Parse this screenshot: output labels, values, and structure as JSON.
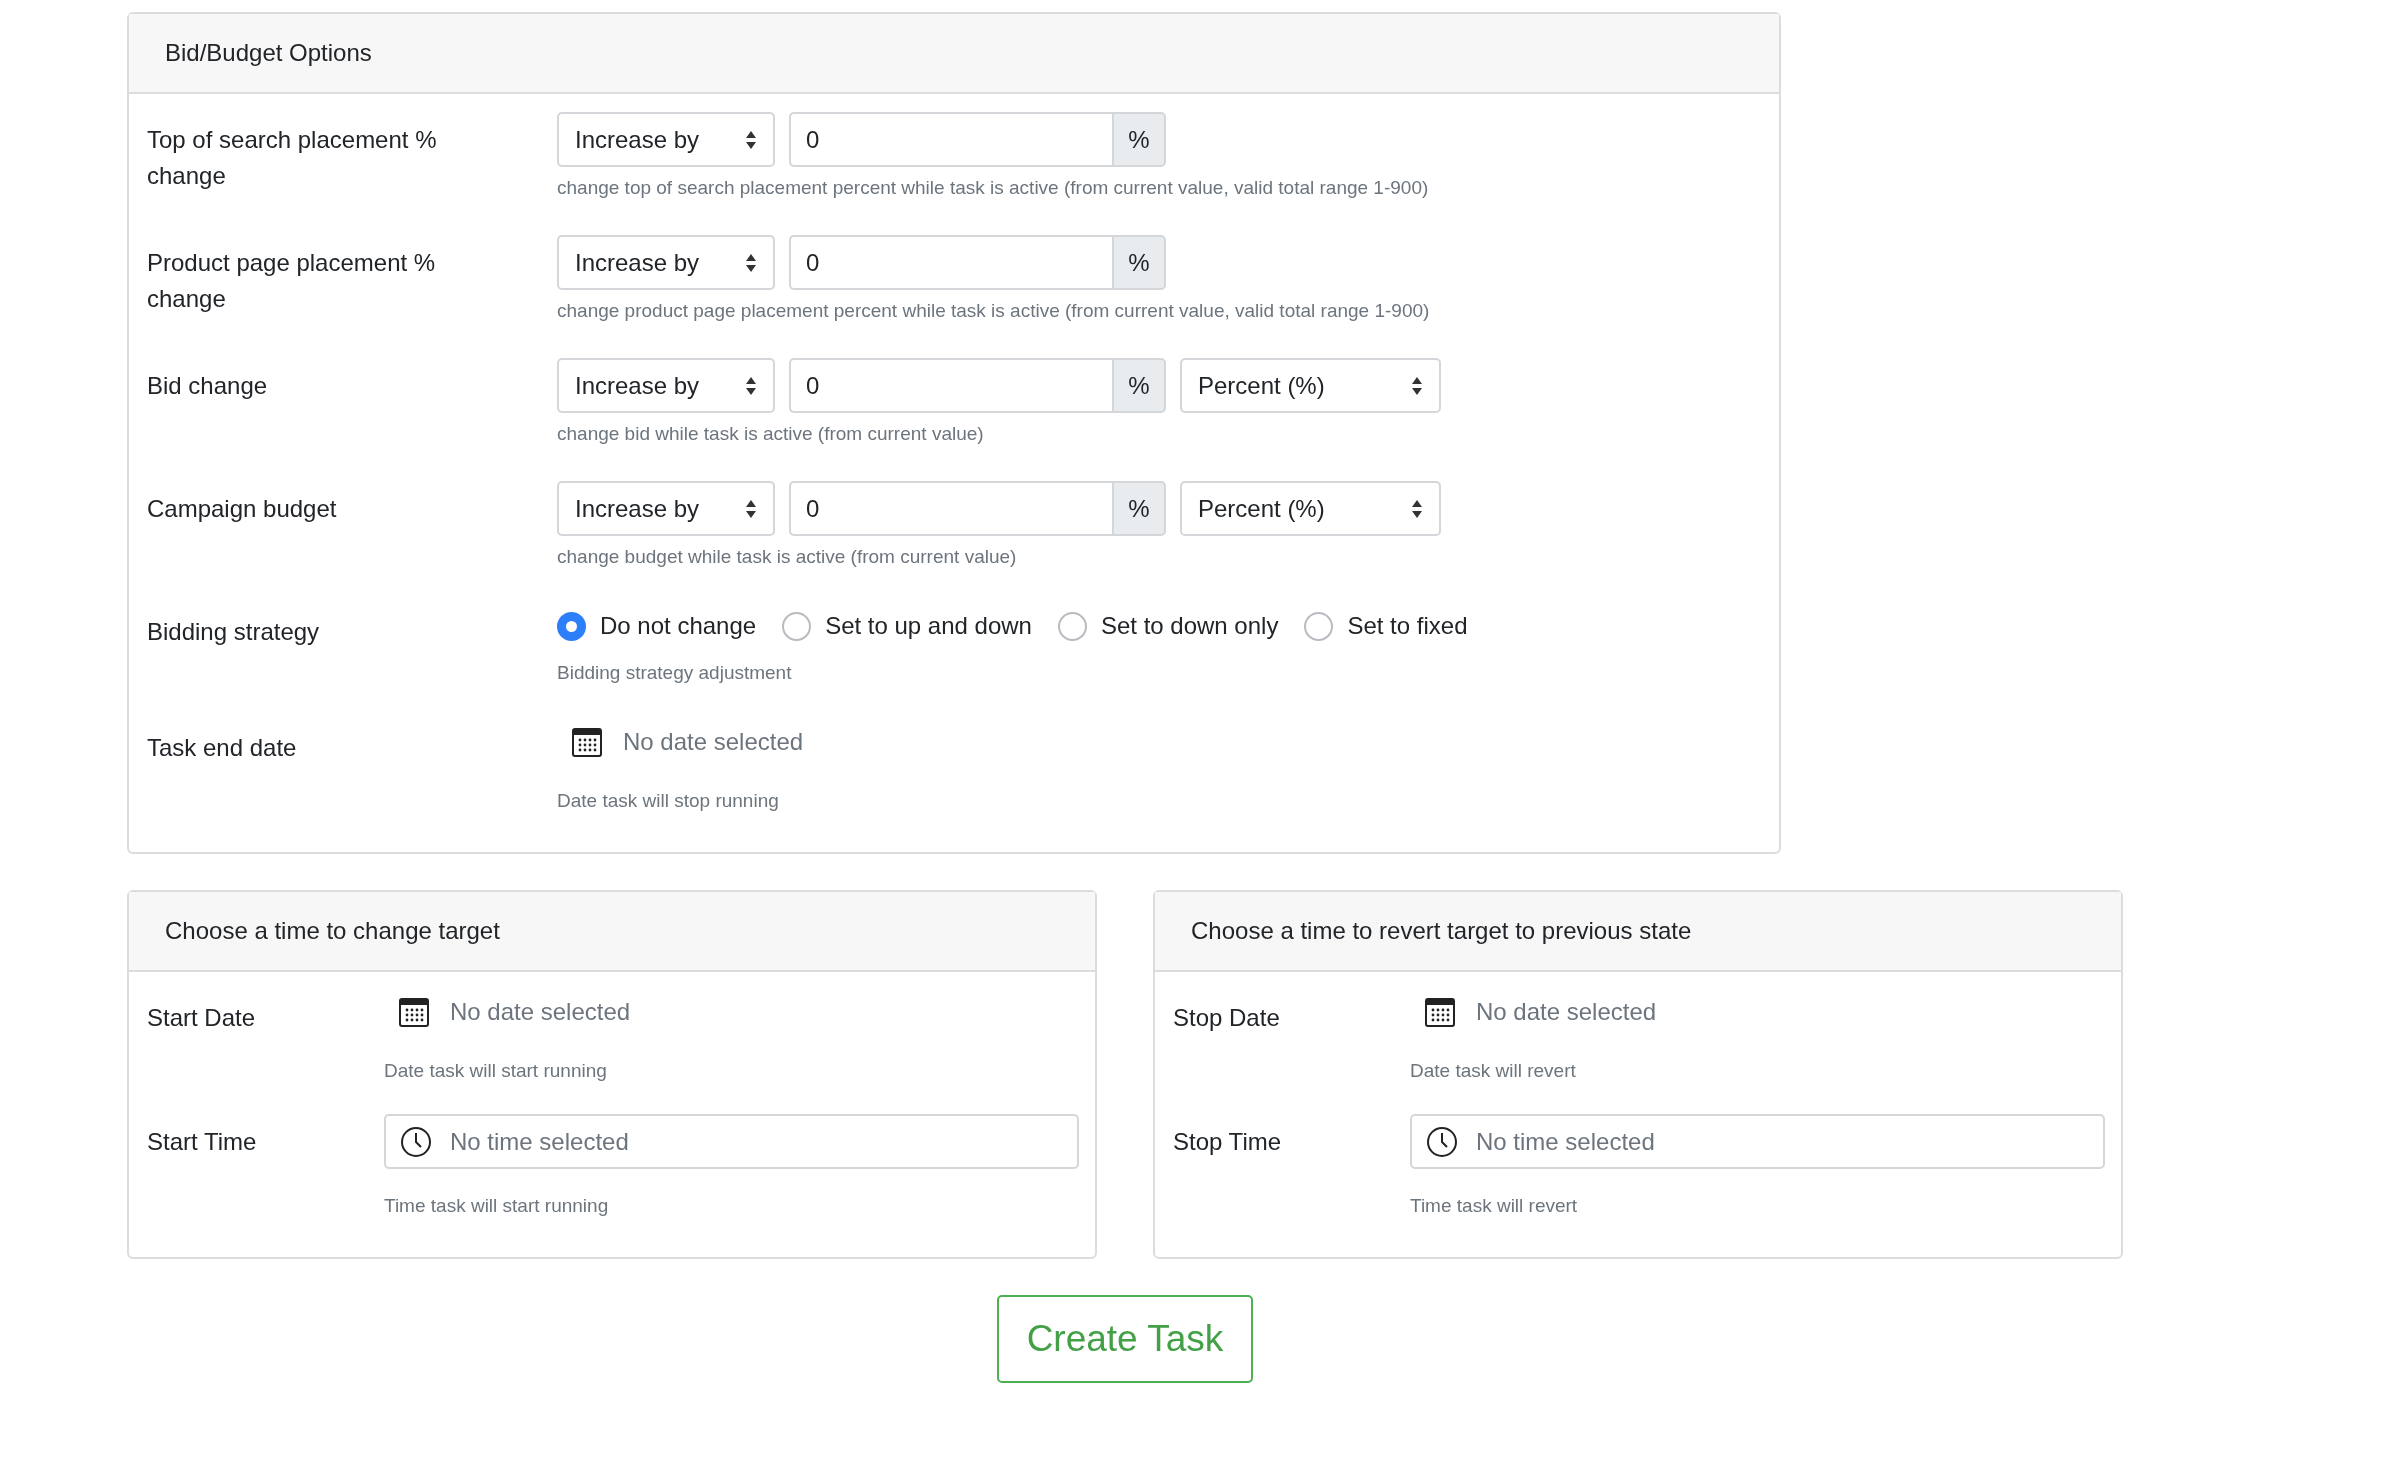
{
  "bid_budget": {
    "title": "Bid/Budget Options",
    "rows": [
      {
        "kind": "adjust",
        "label": "Top of search placement % change",
        "mode": "Increase by",
        "value": "0",
        "unit": "%",
        "help": "change top of search placement percent while task is active (from current value, valid total range 1-900)"
      },
      {
        "kind": "adjust",
        "label": "Product page placement % change",
        "mode": "Increase by",
        "value": "0",
        "unit": "%",
        "help": "change product page placement percent while task is active (from current value, valid total range 1-900)"
      },
      {
        "kind": "adjust",
        "label": "Bid change",
        "mode": "Increase by",
        "value": "0",
        "unit": "%",
        "unit_type": "Percent (%)",
        "help": "change bid while task is active (from current value)"
      },
      {
        "kind": "adjust",
        "label": "Campaign budget",
        "mode": "Increase by",
        "value": "0",
        "unit": "%",
        "unit_type": "Percent (%)",
        "help": "change budget while task is active (from current value)"
      },
      {
        "kind": "radio",
        "label": "Bidding strategy",
        "options": [
          {
            "label": "Do not change",
            "selected": true
          },
          {
            "label": "Set to up and down",
            "selected": false
          },
          {
            "label": "Set to down only",
            "selected": false
          },
          {
            "label": "Set to fixed",
            "selected": false
          }
        ],
        "help": "Bidding strategy adjustment"
      },
      {
        "kind": "date",
        "label": "Task end date",
        "placeholder": "No date selected",
        "help": "Date task will stop running"
      }
    ]
  },
  "schedule": [
    {
      "title": "Choose a time to change target",
      "rows": [
        {
          "kind": "date",
          "label": "Start Date",
          "placeholder": "No date selected",
          "help": "Date task will start running"
        },
        {
          "kind": "time",
          "label": "Start Time",
          "placeholder": "No time selected",
          "help": "Time task will start running"
        }
      ]
    },
    {
      "title": "Choose a time to revert target to previous state",
      "rows": [
        {
          "kind": "date",
          "label": "Stop Date",
          "placeholder": "No date selected",
          "help": "Date task will revert"
        },
        {
          "kind": "time",
          "label": "Stop Time",
          "placeholder": "No time selected",
          "help": "Time task will revert"
        }
      ]
    }
  ],
  "submit": "Create Task"
}
